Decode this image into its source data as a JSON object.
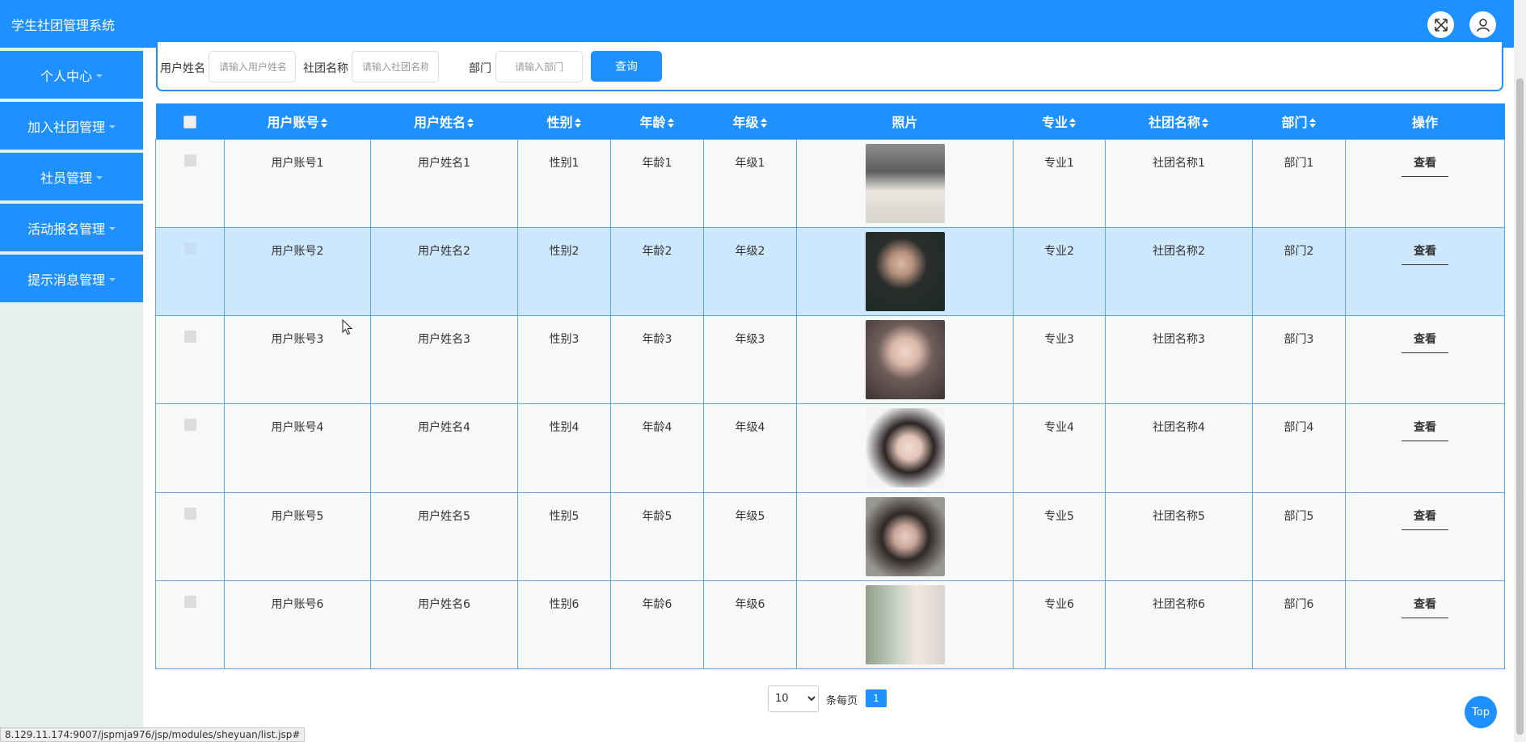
{
  "header": {
    "title": "学生社团管理系统",
    "fullscreen_icon": "expand-icon",
    "user_icon": "user-icon"
  },
  "sidebar": {
    "items": [
      {
        "label": "个人中心"
      },
      {
        "label": "加入社团管理"
      },
      {
        "label": "社员管理"
      },
      {
        "label": "活动报名管理"
      },
      {
        "label": "提示消息管理"
      }
    ]
  },
  "search": {
    "username_label": "用户姓名",
    "username_placeholder": "请输入用户姓名",
    "club_label": "社团名称",
    "club_placeholder": "请输入社团名称",
    "dept_label": "部门",
    "dept_placeholder": "请输入部门",
    "query_label": "查询"
  },
  "table": {
    "headers": {
      "account": "用户账号",
      "name": "用户姓名",
      "gender": "性别",
      "age": "年龄",
      "grade": "年级",
      "photo": "照片",
      "major": "专业",
      "club": "社团名称",
      "dept": "部门",
      "actions": "操作"
    },
    "rows": [
      {
        "account": "用户账号1",
        "name": "用户姓名1",
        "gender": "性别1",
        "age": "年龄1",
        "grade": "年级1",
        "major": "专业1",
        "club": "社团名称1",
        "dept": "部门1",
        "action": "查看"
      },
      {
        "account": "用户账号2",
        "name": "用户姓名2",
        "gender": "性别2",
        "age": "年龄2",
        "grade": "年级2",
        "major": "专业2",
        "club": "社团名称2",
        "dept": "部门2",
        "action": "查看"
      },
      {
        "account": "用户账号3",
        "name": "用户姓名3",
        "gender": "性别3",
        "age": "年龄3",
        "grade": "年级3",
        "major": "专业3",
        "club": "社团名称3",
        "dept": "部门3",
        "action": "查看"
      },
      {
        "account": "用户账号4",
        "name": "用户姓名4",
        "gender": "性别4",
        "age": "年龄4",
        "grade": "年级4",
        "major": "专业4",
        "club": "社团名称4",
        "dept": "部门4",
        "action": "查看"
      },
      {
        "account": "用户账号5",
        "name": "用户姓名5",
        "gender": "性别5",
        "age": "年龄5",
        "grade": "年级5",
        "major": "专业5",
        "club": "社团名称5",
        "dept": "部门5",
        "action": "查看"
      },
      {
        "account": "用户账号6",
        "name": "用户姓名6",
        "gender": "性别6",
        "age": "年龄6",
        "grade": "年级6",
        "major": "专业6",
        "club": "社团名称6",
        "dept": "部门6",
        "action": "查看"
      }
    ]
  },
  "pagination": {
    "page_size": "10",
    "page_size_options": [
      "10"
    ],
    "per_page_text": "条每页",
    "current_page": "1"
  },
  "top_button": "Top",
  "status_url": "8.129.11.174:9007/jspmja976/jsp/modules/sheyuan/list.jsp#",
  "colors": {
    "primary": "#1e90ff",
    "sidebar_bg": "#e4f0ec",
    "selected_row": "#cde7fd",
    "row_bg": "#f8f8f8"
  }
}
